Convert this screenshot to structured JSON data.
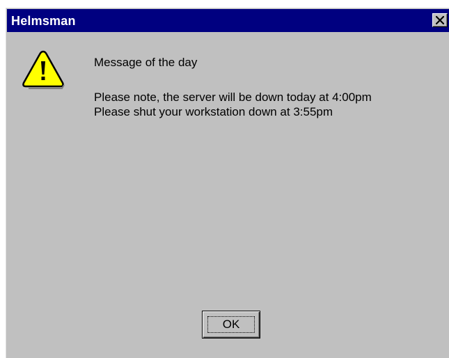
{
  "window": {
    "title": "Helmsman",
    "close_icon": "close-icon"
  },
  "icon": "warning-icon",
  "message": {
    "title": "Message of the day",
    "line1": "Please note, the server will be down today at 4:00pm",
    "line2": "Please shut your workstation down at 3:55pm"
  },
  "buttons": {
    "ok_label": "OK"
  },
  "colors": {
    "titlebar": "#000080",
    "face": "#c0c0c0",
    "warning_fill": "#ffff00"
  }
}
